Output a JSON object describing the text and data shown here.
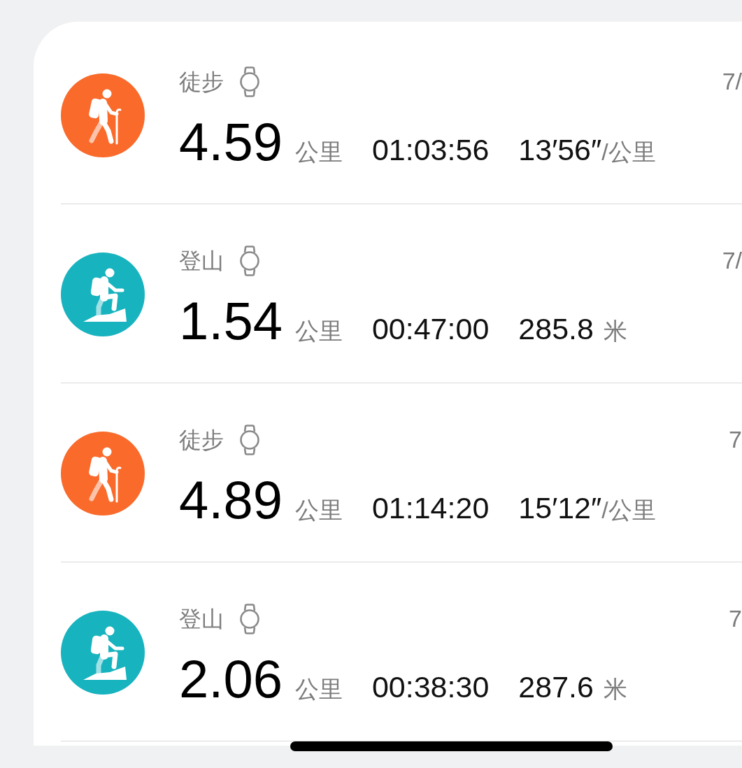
{
  "activities": [
    {
      "kind": "hiking",
      "color": "#f96a2b",
      "title": "徒步",
      "date": "7/",
      "distance": {
        "value": "4.59",
        "unit": "公里"
      },
      "stats": [
        {
          "kind": "duration",
          "value": "01:03:56"
        },
        {
          "kind": "pace",
          "value": "13′56″",
          "unit": "/公里"
        }
      ]
    },
    {
      "kind": "climbing",
      "color": "#17b3bf",
      "title": "登山",
      "date": "7/",
      "distance": {
        "value": "1.54",
        "unit": "公里"
      },
      "stats": [
        {
          "kind": "duration",
          "value": "00:47:00"
        },
        {
          "kind": "elevation",
          "value": "285.8",
          "unit": "米"
        }
      ]
    },
    {
      "kind": "hiking",
      "color": "#f96a2b",
      "title": "徒步",
      "date": "7",
      "distance": {
        "value": "4.89",
        "unit": "公里"
      },
      "stats": [
        {
          "kind": "duration",
          "value": "01:14:20"
        },
        {
          "kind": "pace",
          "value": "15′12″",
          "unit": "/公里"
        }
      ]
    },
    {
      "kind": "climbing",
      "color": "#17b3bf",
      "title": "登山",
      "date": "7",
      "distance": {
        "value": "2.06",
        "unit": "公里"
      },
      "stats": [
        {
          "kind": "duration",
          "value": "00:38:30"
        },
        {
          "kind": "elevation",
          "value": "287.6",
          "unit": "米"
        }
      ]
    }
  ]
}
